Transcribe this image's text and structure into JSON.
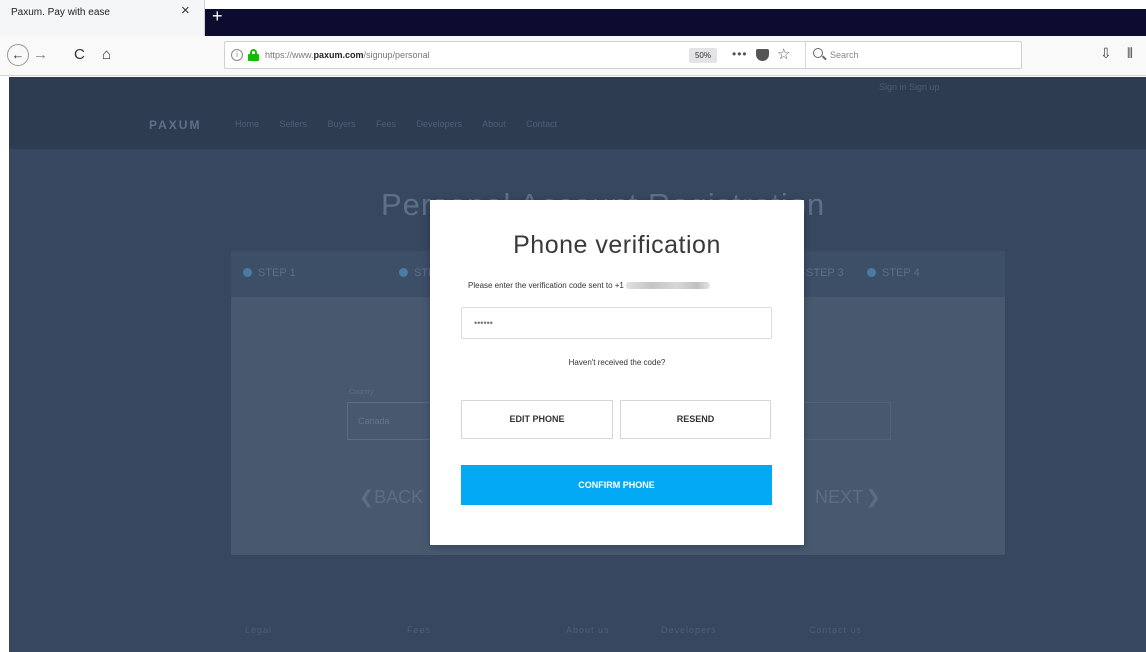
{
  "browser": {
    "tab_title": "Paxum. Pay with ease",
    "tab_close": "×",
    "new_tab": "+",
    "back": "←",
    "forward": "→",
    "reload": "C",
    "home": "⌂",
    "info": "i",
    "url_prefix": "https://www.",
    "url_domain": "paxum.com",
    "url_path": "/signup/personal",
    "zoom": "50%",
    "more": "•••",
    "star": "☆",
    "search_placeholder": "Search",
    "download": "⇩",
    "library": "⫴"
  },
  "site": {
    "top_links": "Sign in   Sign up",
    "logo": "PAXUM",
    "nav": "Home Sellers Buyers Fees Developers About Contact",
    "heading": "Personal Account Registration",
    "steps": [
      "STEP 1",
      "STEP 2",
      "STEP 3",
      "STEP 4"
    ],
    "field_label": "Country",
    "field_value": "Canada",
    "back_label": "BACK",
    "next_label": "NEXT",
    "back_arrow": "❮",
    "next_arrow": "❯",
    "footer": {
      "legal": "Legal",
      "fees": "Fees",
      "about": "About us",
      "developers": "Developers",
      "contact": "Contact us"
    }
  },
  "modal": {
    "title": "Phone verification",
    "prompt": "Please enter the verification code sent to +1",
    "code_placeholder": "••••••",
    "resend_question": "Haven't received the code?",
    "edit_phone_label": "EDIT PHONE",
    "resend_label": "RESEND",
    "confirm_label": "CONFIRM PHONE"
  },
  "colors": {
    "overlay_bg": "#37475f",
    "confirm_button": "#03a9f4",
    "lock_green": "#12bc00"
  }
}
